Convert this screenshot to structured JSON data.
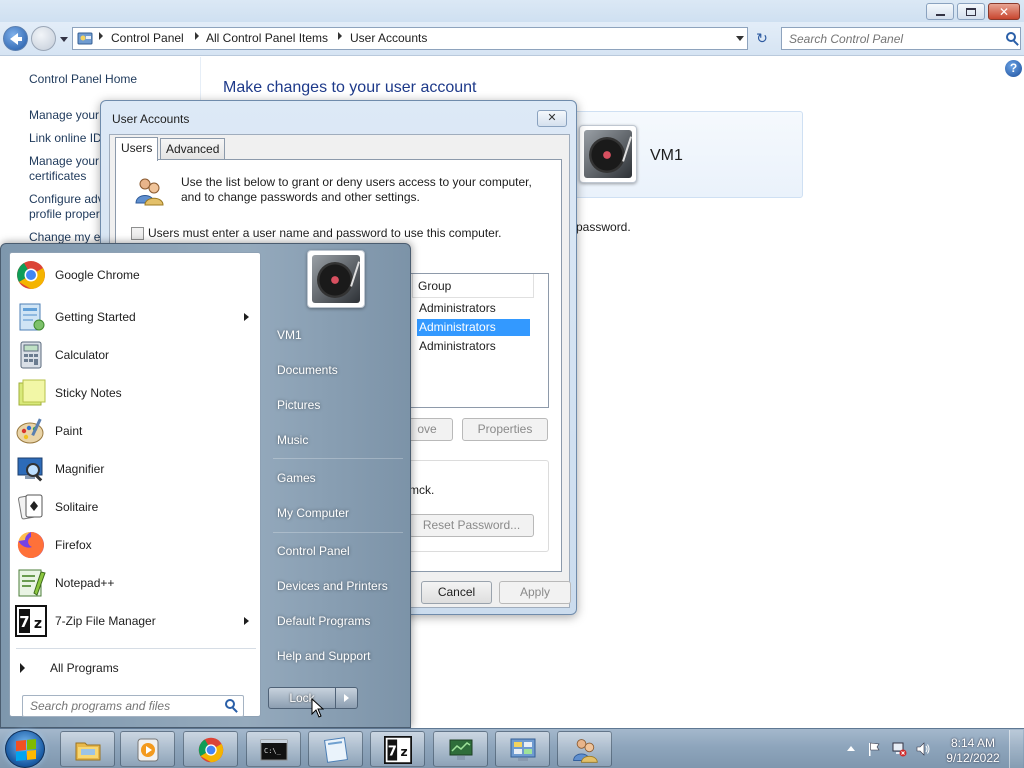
{
  "control_panel": {
    "breadcrumbs": [
      "Control Panel",
      "All Control Panel Items",
      "User Accounts"
    ],
    "search_placeholder": "Search Control Panel",
    "left_nav": [
      "Control Panel Home",
      "Manage your",
      "Link online ID",
      "Manage your",
      "certificates",
      "Configure adv",
      "profile proper",
      "Change my e"
    ],
    "heading": "Make changes to your user account",
    "account_name": "VM1",
    "password_fragment": "password."
  },
  "user_accounts_dialog": {
    "title": "User Accounts",
    "close_glyph": "✕",
    "tabs": [
      "Users",
      "Advanced"
    ],
    "description": "Use the list below to grant or deny users access to your computer, and to change passwords and other settings.",
    "must_enter_label": "Users must enter a user name and password to use this computer.",
    "must_enter_checked": false,
    "list_column_group": "Group",
    "list_groups": [
      "Administrators",
      "Administrators",
      "Administrators"
    ],
    "selected_row": 1,
    "remove_label": "ove",
    "properties_label": "Properties",
    "password_text": "mck.",
    "reset_password_label": "Reset Password...",
    "cancel_label": "Cancel",
    "apply_label": "Apply"
  },
  "start_menu": {
    "programs": [
      {
        "label": "Google Chrome",
        "icon": "chrome-icon",
        "submenu": false
      },
      {
        "label": "Getting Started",
        "icon": "getting-started-icon",
        "submenu": true
      },
      {
        "label": "Calculator",
        "icon": "calculator-icon",
        "submenu": false
      },
      {
        "label": "Sticky Notes",
        "icon": "sticky-notes-icon",
        "submenu": false
      },
      {
        "label": "Paint",
        "icon": "paint-icon",
        "submenu": false
      },
      {
        "label": "Magnifier",
        "icon": "magnifier-icon",
        "submenu": false
      },
      {
        "label": "Solitaire",
        "icon": "solitaire-icon",
        "submenu": false
      },
      {
        "label": "Firefox",
        "icon": "firefox-icon",
        "submenu": false
      },
      {
        "label": "Notepad++",
        "icon": "notepadpp-icon",
        "submenu": false
      },
      {
        "label": "7-Zip File Manager",
        "icon": "7zip-icon",
        "submenu": true
      }
    ],
    "all_programs": "All Programs",
    "search_placeholder": "Search programs and files",
    "right_links": [
      "VM1",
      "Documents",
      "Pictures",
      "Music",
      "Games",
      "My Computer",
      "Control Panel",
      "Devices and Printers",
      "Default Programs",
      "Help and Support"
    ],
    "lock_label": "Lock"
  },
  "taskbar": {
    "pinned": [
      "explorer-icon",
      "media-player-icon",
      "chrome-icon",
      "cmd-icon",
      "notepad-icon",
      "7zip-icon",
      "network-icon",
      "control-panel-icon",
      "user-accounts-icon"
    ],
    "time": "8:14 AM",
    "date": "9/12/2022"
  }
}
